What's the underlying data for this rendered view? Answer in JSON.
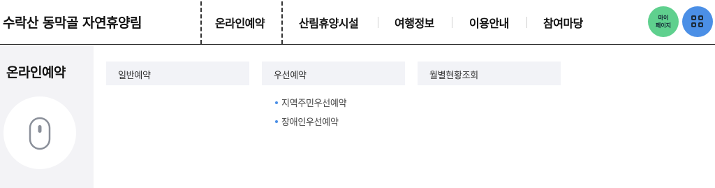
{
  "header": {
    "site_title": "수락산 동막골 자연휴양림",
    "nav": [
      {
        "label": "온라인예약",
        "active": true
      },
      {
        "label": "산림휴양시설"
      },
      {
        "label": "여행정보"
      },
      {
        "label": "이용안내"
      },
      {
        "label": "참여마당"
      }
    ],
    "mypage": {
      "line1": "마이",
      "line2": "페이지",
      "color": "#5fd08e"
    },
    "allmenu": {
      "icon": "grid-icon",
      "color": "#4b8fe6"
    }
  },
  "submenu": {
    "title": "온라인예약",
    "illustration": "mouse-icon",
    "categories": [
      {
        "label": "일반예약",
        "items": []
      },
      {
        "label": "우선예약",
        "items": [
          "지역주민우선예약",
          "장애인우선예약"
        ]
      },
      {
        "label": "월별현황조회",
        "items": []
      }
    ],
    "bullet_color": "#4b8fe6"
  }
}
